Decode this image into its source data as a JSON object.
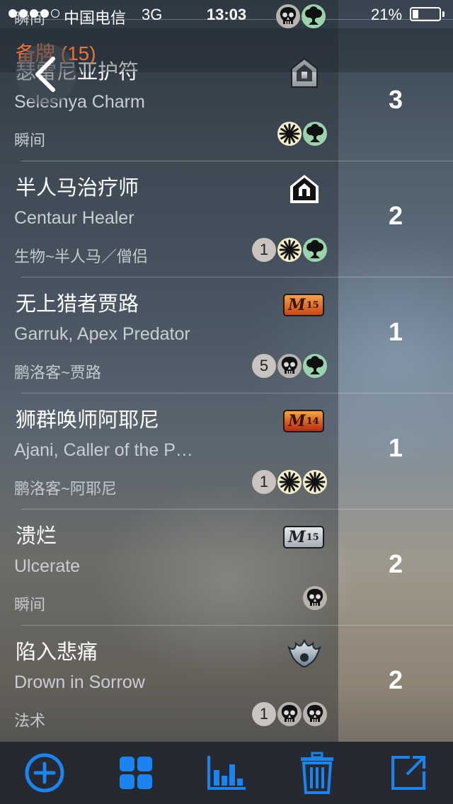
{
  "status_bar": {
    "carrier": "中国电信",
    "network": "3G",
    "time": "13:03",
    "battery_percent": "21%",
    "battery_level": 0.21,
    "signal_dots_filled": 4,
    "deck_colors": [
      "black-mana-icon",
      "green-mana-icon"
    ]
  },
  "header": {
    "title": "备牌 (15)",
    "title_color": "#e8733a"
  },
  "cards": [
    {
      "name_cn": "瞬间",
      "partial": true
    },
    {
      "name_cn": "瑟雷尼亚护符",
      "name_en": "Selesnya Charm",
      "type": "瞬间",
      "set": "return-to-ravnica",
      "count": "3",
      "mana": [
        {
          "kind": "w"
        },
        {
          "kind": "g"
        }
      ]
    },
    {
      "name_cn": "半人马治疗师",
      "name_en": "Centaur Healer",
      "type": "生物~半人马／僧侣",
      "set": "return-to-ravnica-black",
      "count": "2",
      "mana": [
        {
          "kind": "num",
          "value": "1"
        },
        {
          "kind": "w"
        },
        {
          "kind": "g"
        }
      ]
    },
    {
      "name_cn": "无上猎者贾路",
      "name_en": "Garruk, Apex Predator",
      "type": "鹏洛客~贾路",
      "set_badge": {
        "label": "M",
        "sup": "15",
        "style": "orange"
      },
      "count": "1",
      "mana": [
        {
          "kind": "num",
          "value": "5"
        },
        {
          "kind": "b"
        },
        {
          "kind": "g"
        }
      ]
    },
    {
      "name_cn": "狮群唤师阿耶尼",
      "name_en": "Ajani, Caller of the P…",
      "type": "鹏洛客~阿耶尼",
      "set_badge": {
        "label": "M",
        "sup": "14",
        "style": "red"
      },
      "count": "1",
      "mana": [
        {
          "kind": "num",
          "value": "1"
        },
        {
          "kind": "w"
        },
        {
          "kind": "w"
        }
      ]
    },
    {
      "name_cn": "溃烂",
      "name_en": "Ulcerate",
      "type": "瞬间",
      "set_badge": {
        "label": "M",
        "sup": "15",
        "style": "silver"
      },
      "count": "2",
      "mana": [
        {
          "kind": "b"
        }
      ]
    },
    {
      "name_cn": "陷入悲痛",
      "name_en": "Drown in Sorrow",
      "type": "法术",
      "set": "born-of-the-gods",
      "count": "2",
      "mana": [
        {
          "kind": "num",
          "value": "1"
        },
        {
          "kind": "b"
        },
        {
          "kind": "b"
        }
      ]
    }
  ],
  "toolbar": {
    "accent": "#1a84f0",
    "buttons": [
      "add-icon",
      "grid-view-icon",
      "chart-icon",
      "trash-icon",
      "export-icon"
    ]
  }
}
